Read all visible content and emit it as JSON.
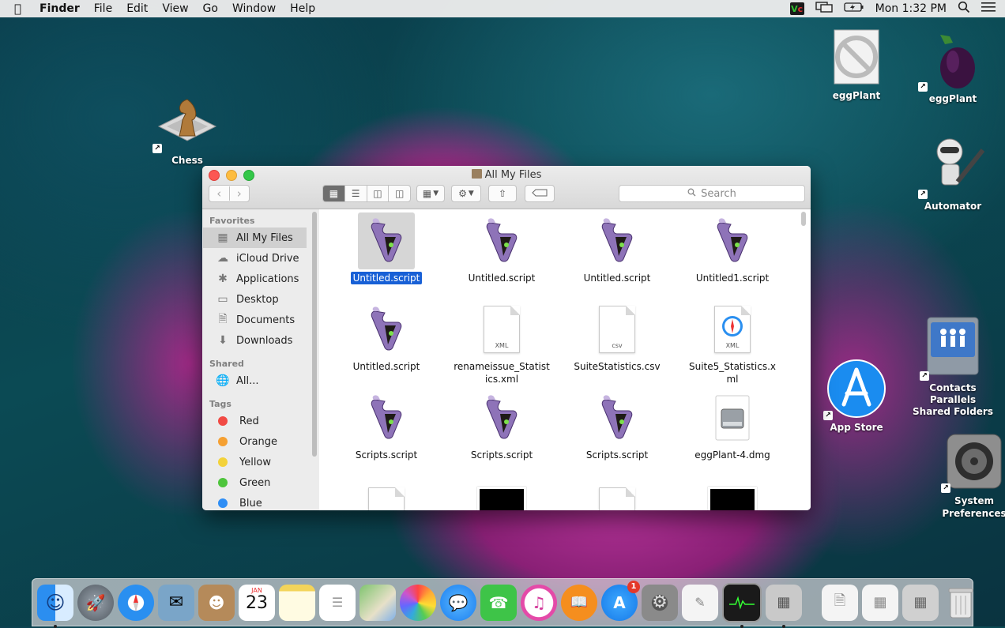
{
  "menubar": {
    "app": "Finder",
    "items": [
      "File",
      "Edit",
      "View",
      "Go",
      "Window",
      "Help"
    ],
    "clock": "Mon 1:32 PM"
  },
  "desktop": {
    "icons": [
      {
        "label": "Chess"
      },
      {
        "label": "eggPlant"
      },
      {
        "label": "eggPlant"
      },
      {
        "label": "Automator"
      },
      {
        "label": "Contacts Parallels Shared Folders"
      },
      {
        "label": "App Store"
      },
      {
        "label": "System Preferences"
      }
    ]
  },
  "finder": {
    "title": "All My Files",
    "search_placeholder": "Search",
    "sidebar": {
      "favorites_header": "Favorites",
      "favorites": [
        "All My Files",
        "iCloud Drive",
        "Applications",
        "Desktop",
        "Documents",
        "Downloads"
      ],
      "shared_header": "Shared",
      "shared": [
        "All..."
      ],
      "tags_header": "Tags",
      "tags": [
        {
          "name": "Red",
          "color": "#f14a44"
        },
        {
          "name": "Orange",
          "color": "#f5a032"
        },
        {
          "name": "Yellow",
          "color": "#f3d23a"
        },
        {
          "name": "Green",
          "color": "#4ec53c"
        },
        {
          "name": "Blue",
          "color": "#2f8ef5"
        }
      ]
    },
    "files": [
      {
        "name": "Untitled.script",
        "kind": "script",
        "selected": true
      },
      {
        "name": "Untitled.script",
        "kind": "script"
      },
      {
        "name": "Untitled.script",
        "kind": "script"
      },
      {
        "name": "Untitled1.script",
        "kind": "script"
      },
      {
        "name": "Untitled.script",
        "kind": "script"
      },
      {
        "name": "renameissue_Statistics.xml",
        "kind": "doc",
        "ext": "XML"
      },
      {
        "name": "SuiteStatistics.csv",
        "kind": "doc",
        "ext": "csv"
      },
      {
        "name": "Suite5_Statistics.xml",
        "kind": "safari-doc",
        "ext": "XML"
      },
      {
        "name": "Scripts.script",
        "kind": "script"
      },
      {
        "name": "Scripts.script",
        "kind": "script"
      },
      {
        "name": "Scripts.script",
        "kind": "script"
      },
      {
        "name": "eggPlant-4.dmg",
        "kind": "dmg"
      }
    ],
    "file_name_lines": {
      "f5": [
        "renameissue_Statist",
        "ics.xml"
      ],
      "f7": [
        "Suite5_Statistics.x",
        "ml"
      ]
    }
  },
  "dock": {
    "apps": [
      "finder-icon",
      "launchpad-icon",
      "safari-icon",
      "mail-icon",
      "contacts-icon",
      "calendar-icon",
      "notes-icon",
      "reminders-icon",
      "maps-icon",
      "photos-icon",
      "messages-icon",
      "facetime-icon",
      "itunes-icon",
      "ibooks-icon",
      "app-store-icon",
      "system-preferences-icon",
      "textedit-icon",
      "activity-monitor-icon",
      "calculator-icon"
    ],
    "calendar_month": "JAN",
    "calendar_day": "23",
    "app_store_badge": "1"
  }
}
